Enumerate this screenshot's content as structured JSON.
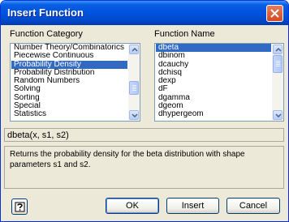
{
  "window": {
    "title": "Insert Function"
  },
  "category": {
    "label": "Function Category",
    "items": [
      {
        "label": "Number Theory/Combinatorics",
        "selected": false
      },
      {
        "label": "Piecewise Continuous",
        "selected": false
      },
      {
        "label": "Probability Density",
        "selected": true
      },
      {
        "label": "Probability Distribution",
        "selected": false
      },
      {
        "label": "Random Numbers",
        "selected": false
      },
      {
        "label": "Solving",
        "selected": false
      },
      {
        "label": "Sorting",
        "selected": false
      },
      {
        "label": "Special",
        "selected": false
      },
      {
        "label": "Statistics",
        "selected": false
      }
    ]
  },
  "function_name": {
    "label": "Function Name",
    "items": [
      {
        "label": "dbeta",
        "selected": true
      },
      {
        "label": "dbinom",
        "selected": false
      },
      {
        "label": "dcauchy",
        "selected": false
      },
      {
        "label": "dchisq",
        "selected": false
      },
      {
        "label": "dexp",
        "selected": false
      },
      {
        "label": "dF",
        "selected": false
      },
      {
        "label": "dgamma",
        "selected": false
      },
      {
        "label": "dgeom",
        "selected": false
      },
      {
        "label": "dhypergeom",
        "selected": false
      }
    ]
  },
  "syntax": "dbeta(x, s1, s2)",
  "description": "Returns the probability density for the beta distribution with shape parameters s1 and s2.",
  "buttons": {
    "ok": "OK",
    "insert": "Insert",
    "cancel": "Cancel"
  },
  "icons": {
    "close": "close-icon",
    "help": "help-icon"
  },
  "colors": {
    "titlebar": "#0054e3",
    "selection": "#316ac5",
    "dialog": "#ece9d8"
  }
}
